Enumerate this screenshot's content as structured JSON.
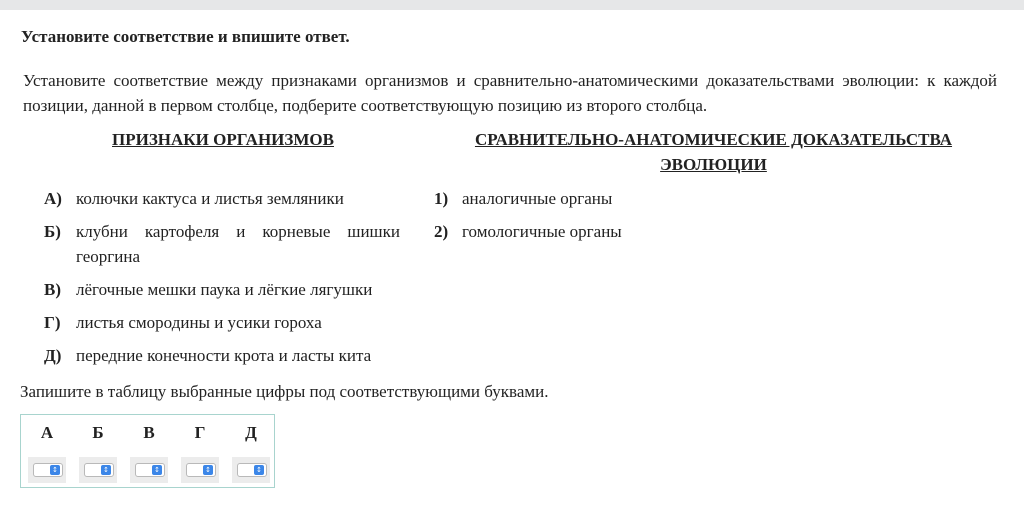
{
  "instruction": "Установите соответствие и впишите ответ.",
  "task_text": "Установите соответствие между признаками организмов и сравнительно-анатомическими доказательствами эволюции: к каждой позиции, данной в первом столбце, подберите соответствующую позицию из второго столбца.",
  "left_column": {
    "header": "ПРИЗНАКИ ОРГАНИЗМОВ",
    "items": [
      {
        "letter": "А)",
        "text": "колючки кактуса и листья земляники"
      },
      {
        "letter": "Б)",
        "text": "клубни картофеля и корневые шишки георгина"
      },
      {
        "letter": "В)",
        "text": "лёгочные мешки паука и лёгкие лягушки"
      },
      {
        "letter": "Г)",
        "text": "листья смородины и усики гороха"
      },
      {
        "letter": "Д)",
        "text": "передние конечности крота и ласты кита"
      }
    ]
  },
  "right_column": {
    "header": "СРАВНИТЕЛЬНО-АНАТОМИЧЕСКИЕ ДОКАЗАТЕЛЬСТВА ЭВОЛЮЦИИ",
    "items": [
      {
        "number": "1)",
        "text": "аналогичные органы"
      },
      {
        "number": "2)",
        "text": "гомологичные органы"
      }
    ]
  },
  "footer_text": "Запишите в таблицу выбранные цифры под соответствующими буквами.",
  "answer_table": {
    "headers": [
      "А",
      "Б",
      "В",
      "Г",
      "Д"
    ],
    "selects": [
      "",
      "",
      "",
      "",
      ""
    ]
  },
  "icons": {
    "select_arrows": "up-down-chevron-icon"
  },
  "colors": {
    "table_border": "#a8d4ce",
    "select_accent": "#3b86e8"
  }
}
